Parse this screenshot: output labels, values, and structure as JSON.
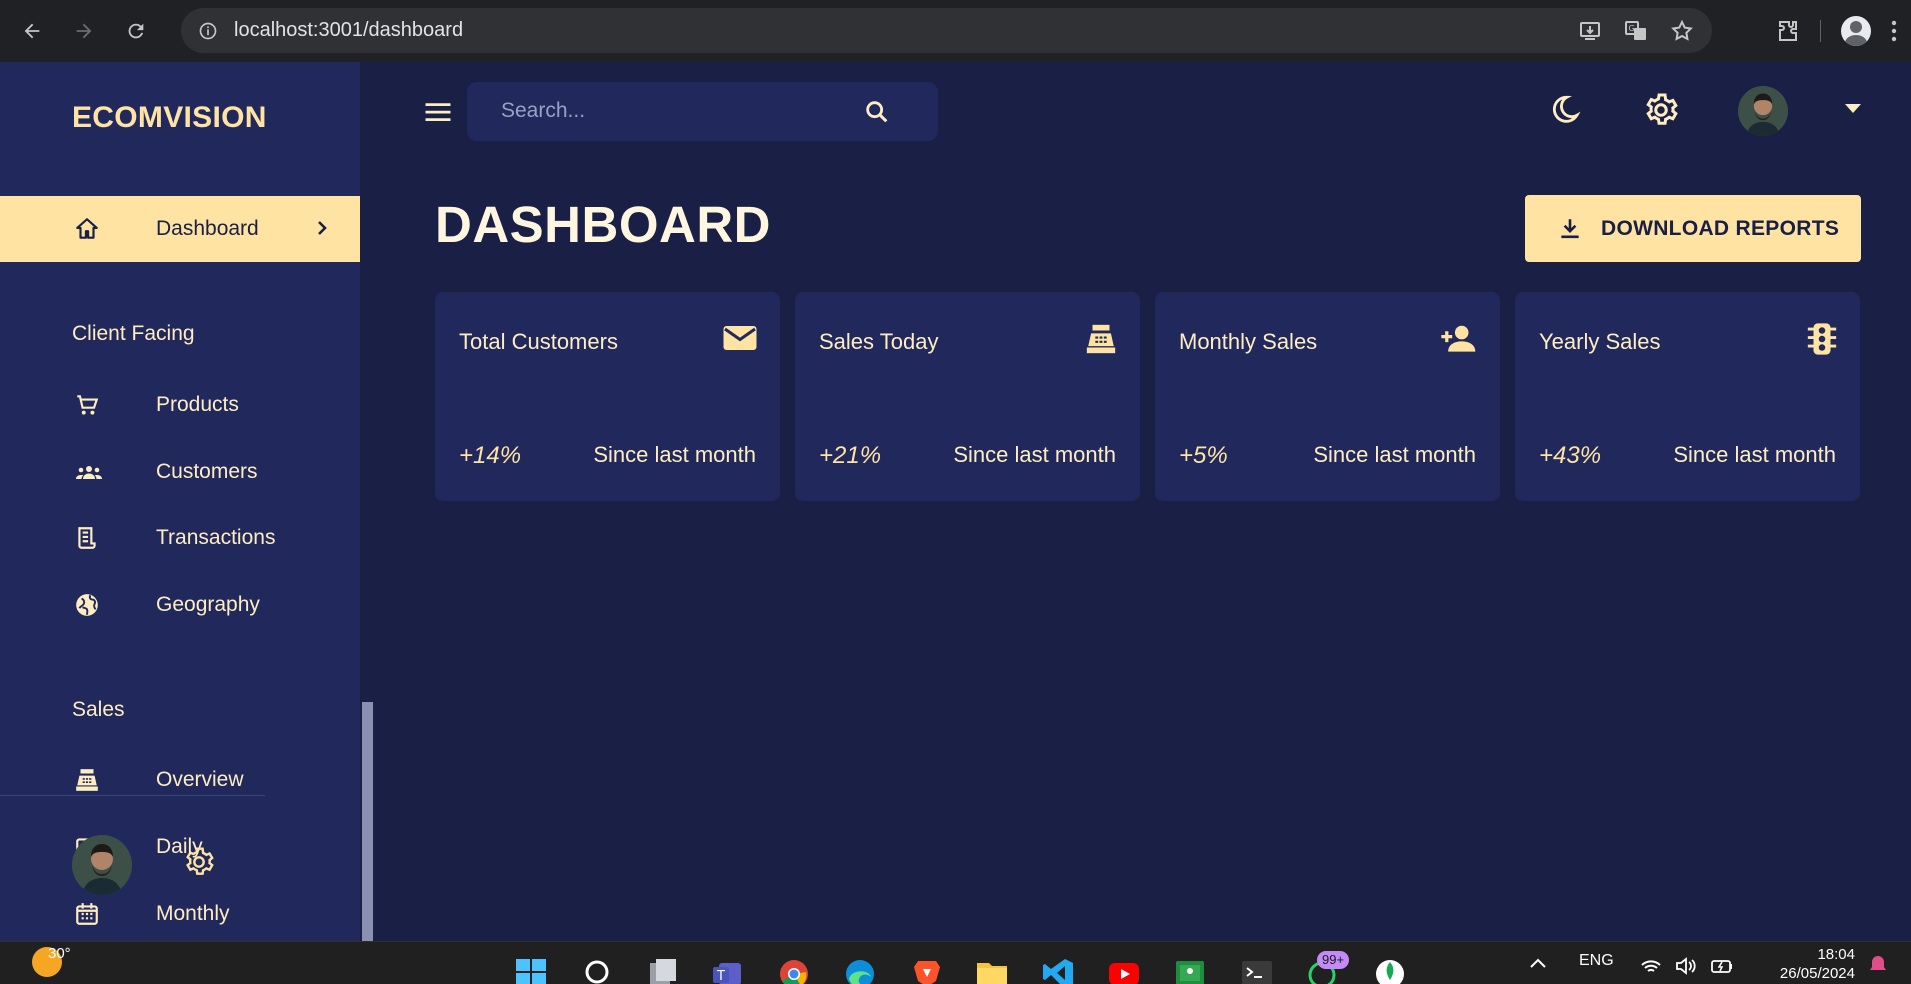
{
  "browser": {
    "url": "localhost:3001/dashboard"
  },
  "app": {
    "brand": "ECOMVISION",
    "search": {
      "placeholder": "Search..."
    }
  },
  "sidebar": {
    "active_item": "Dashboard",
    "sections": [
      {
        "title": "Client Facing",
        "items": [
          "Products",
          "Customers",
          "Transactions",
          "Geography"
        ]
      },
      {
        "title": "Sales",
        "items": [
          "Overview",
          "Daily",
          "Monthly"
        ]
      }
    ]
  },
  "page": {
    "title": "DASHBOARD",
    "download_label": "DOWNLOAD REPORTS"
  },
  "stats": [
    {
      "title": "Total Customers",
      "increase": "+14%",
      "description": "Since last month",
      "icon": "email-icon"
    },
    {
      "title": "Sales Today",
      "increase": "+21%",
      "description": "Since last month",
      "icon": "point-of-sale-icon"
    },
    {
      "title": "Monthly Sales",
      "increase": "+5%",
      "description": "Since last month",
      "icon": "person-add-icon"
    },
    {
      "title": "Yearly Sales",
      "increase": "+43%",
      "description": "Since last month",
      "icon": "traffic-icon"
    }
  ],
  "taskbar": {
    "temperature": "30°",
    "language": "ENG",
    "time": "18:04",
    "date": "26/05/2024",
    "notification_badge": "99+"
  },
  "colors": {
    "background": "#191f45",
    "panel": "#21295c",
    "accent": "#ffe3a3",
    "text": "#ffedc2"
  }
}
